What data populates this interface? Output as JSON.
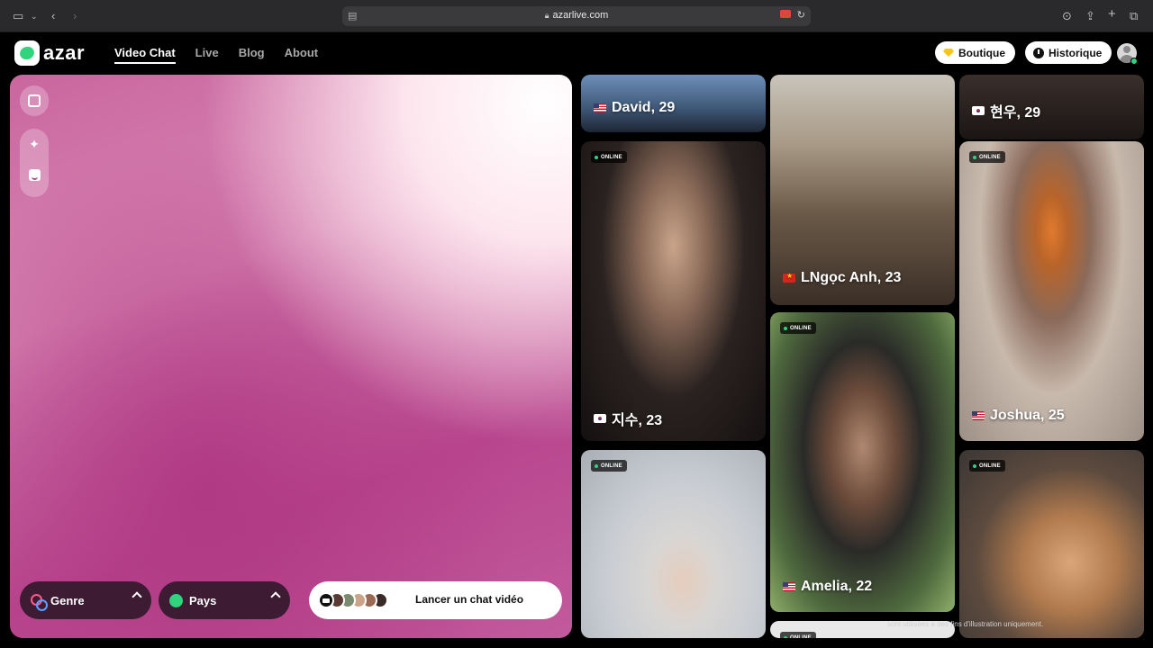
{
  "browser": {
    "url": "azarlive.com"
  },
  "header": {
    "logo_text": "azar",
    "nav": [
      {
        "label": "Video Chat",
        "active": true
      },
      {
        "label": "Live",
        "active": false
      },
      {
        "label": "Blog",
        "active": false
      },
      {
        "label": "About",
        "active": false
      }
    ],
    "boutique_label": "Boutique",
    "historique_label": "Historique"
  },
  "video_panel": {
    "tools": [
      "expand-icon",
      "sparkle-icon",
      "face-filter-icon"
    ],
    "genre_label": "Genre",
    "pays_label": "Pays",
    "cta_label": "Lancer un chat vidéo"
  },
  "profiles": [
    {
      "name": "David, 29",
      "flag": "us",
      "online": false
    },
    {
      "name": "LNgọc Anh, 23",
      "flag": "vn",
      "online": false
    },
    {
      "name": "현우, 29",
      "flag": "kr",
      "online": false
    },
    {
      "name": "지수, 23",
      "flag": "kr",
      "online": true
    },
    {
      "name": "Joshua, 25",
      "flag": "us",
      "online": true
    },
    {
      "name": "Amelia, 22",
      "flag": "us",
      "online": true
    },
    {
      "name": "",
      "flag": "",
      "online": true
    },
    {
      "name": "",
      "flag": "",
      "online": true
    },
    {
      "name": "",
      "flag": "",
      "online": true
    }
  ],
  "online_label": "ONLINE",
  "footer_note": "sont utilisées à des fins d'illustration uniquement."
}
